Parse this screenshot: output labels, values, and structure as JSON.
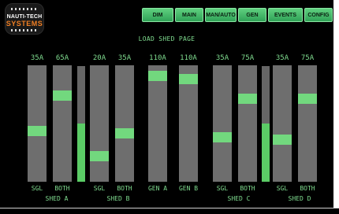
{
  "logo": {
    "line1": "NAUTI-TECH",
    "line2": "SYSTEMS"
  },
  "nav": [
    "DIM",
    "MAIN",
    "MAN/AUTO",
    "GEN",
    "EVENTS",
    "CONFIG"
  ],
  "page_title": "LOAD SHED PAGE",
  "breakers": [
    {
      "id": "shed-a-sgl",
      "amps": "35A",
      "label": "SGL",
      "level": 0.43
    },
    {
      "id": "shed-a-both",
      "amps": "65A",
      "label": "BOTH",
      "level": 0.76
    },
    {
      "id": "shed-b-sgl",
      "amps": "20A",
      "label": "SGL",
      "level": 0.19
    },
    {
      "id": "shed-b-both",
      "amps": "35A",
      "label": "BOTH",
      "level": 0.41
    },
    {
      "id": "gen-a",
      "amps": "110A",
      "label": "GEN A",
      "level": 0.95
    },
    {
      "id": "gen-b",
      "amps": "110A",
      "label": "GEN B",
      "level": 0.92
    },
    {
      "id": "shed-c-sgl",
      "amps": "35A",
      "label": "SGL",
      "level": 0.37
    },
    {
      "id": "shed-c-both",
      "amps": "75A",
      "label": "BOTH",
      "level": 0.73
    },
    {
      "id": "shed-d-sgl",
      "amps": "35A",
      "label": "SGL",
      "level": 0.35
    },
    {
      "id": "shed-d-both",
      "amps": "75A",
      "label": "BOTH",
      "level": 0.73
    }
  ],
  "gauges": [
    {
      "id": "shed-a-load",
      "level": 0.5
    },
    {
      "id": "shed-c-load",
      "level": 0.5
    }
  ],
  "groups": [
    "SHED A",
    "SHED B",
    "SHED C",
    "SHED D"
  ],
  "colors": {
    "background": "#000000",
    "accent": "#7fdc8f",
    "button": "#3cb868",
    "handle": "#72d87e",
    "slot": "#6e6e6e",
    "logo_orange": "#f07f23"
  }
}
